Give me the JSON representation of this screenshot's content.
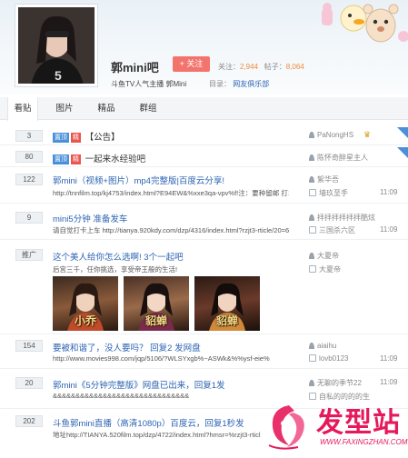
{
  "header": {
    "bar_name": "郭mini吧",
    "follow_label": "+ 关注",
    "members_label": "关注：",
    "members_value": "2,944",
    "posts_label": "帖子：",
    "posts_value": "8,064",
    "description": "斗鱼TV人气主播 郭Mini",
    "catalog_label": "目录：",
    "catalog_value": "网友俱乐部"
  },
  "tabs": [
    {
      "label": "看贴",
      "active": true
    },
    {
      "label": "图片",
      "active": false
    },
    {
      "label": "精品",
      "active": false
    },
    {
      "label": "群组",
      "active": false
    }
  ],
  "threads": [
    {
      "replies": "3",
      "tags": [
        "置顶",
        "精"
      ],
      "title": "【公告】",
      "author": "PaNongHS",
      "crown": "♛"
    },
    {
      "replies": "80",
      "tags": [
        "置顶",
        "精"
      ],
      "title": "一起来水经验吧",
      "author": "陈怀奇醉星主人"
    },
    {
      "replies": "122",
      "title": "郭mini（视频+图片）mp4完整版|百度云分享!",
      "excerpt": "http://tnnfilm.top/kj4753/index.html?E94EW&%xxe3qa-vpv%f!注：要种留邮 打1发",
      "author": "絮华吾",
      "replier": "墙玖至手",
      "time": "11:09"
    },
    {
      "replies": "9",
      "title": "mini5分钟 准备发车",
      "excerpt": "请自觉打卡上车 http://tianya.920kdy.com/dzp/4316/index.html?rzjt3-rticle/20=66c",
      "author": "拝拝拝拝拝拝酷炫",
      "replier": "三国杀六区",
      "time": "11:09"
    },
    {
      "replies": "推广",
      "title": "这个美人给你怎么选啊! 3个一起吧",
      "excerpt": "后宫三千，任你挑选，享受帝王般的生活!",
      "author": "大夏帝",
      "replier": "大夏帝"
    },
    {
      "replies": "154",
      "title": "要被和谐了，没人要吗？ 回复2 发网盘",
      "excerpt": "http://www.movies998.com/jqp/5106/?WLSYxgb%~ASWk&%%ysf-eie%",
      "author": "aiaihu",
      "replier": "lovb0123",
      "time": "11:09"
    },
    {
      "replies": "20",
      "title": "郭mini《5分钟完整版》网盘已出来，回复1发",
      "excerpt": "&&&&&&&&&&&&&&&&&&&&&&&&&&&&&&",
      "author": "无聊的季节22",
      "replier": "自私的的的的生",
      "time": "11:09"
    },
    {
      "replies": "202",
      "title": "斗鱼郭mini直播（高清1080p）百度云，回复1秒发",
      "excerpt": "地址http://TIANYA.520film.top/dzp/4722/index.html?hmsr=%rzjt3-rticl"
    }
  ],
  "game_ad": {
    "thumbs": [
      {
        "label": "小乔",
        "color": "#8a5a3a"
      },
      {
        "label": "貂蝉",
        "color": "#6a3a2a"
      },
      {
        "label": "貂蝉",
        "color": "#4a3028"
      }
    ]
  },
  "watermark": {
    "brand": "发型站",
    "url": "WWW.FAXINGZHAN.COM",
    "color": "#e5195b"
  },
  "colors": {
    "accent": "#2d64b3",
    "follow": "#f2746d",
    "top_tag": "#4a90d9",
    "hot_tag": "#e8574f"
  }
}
